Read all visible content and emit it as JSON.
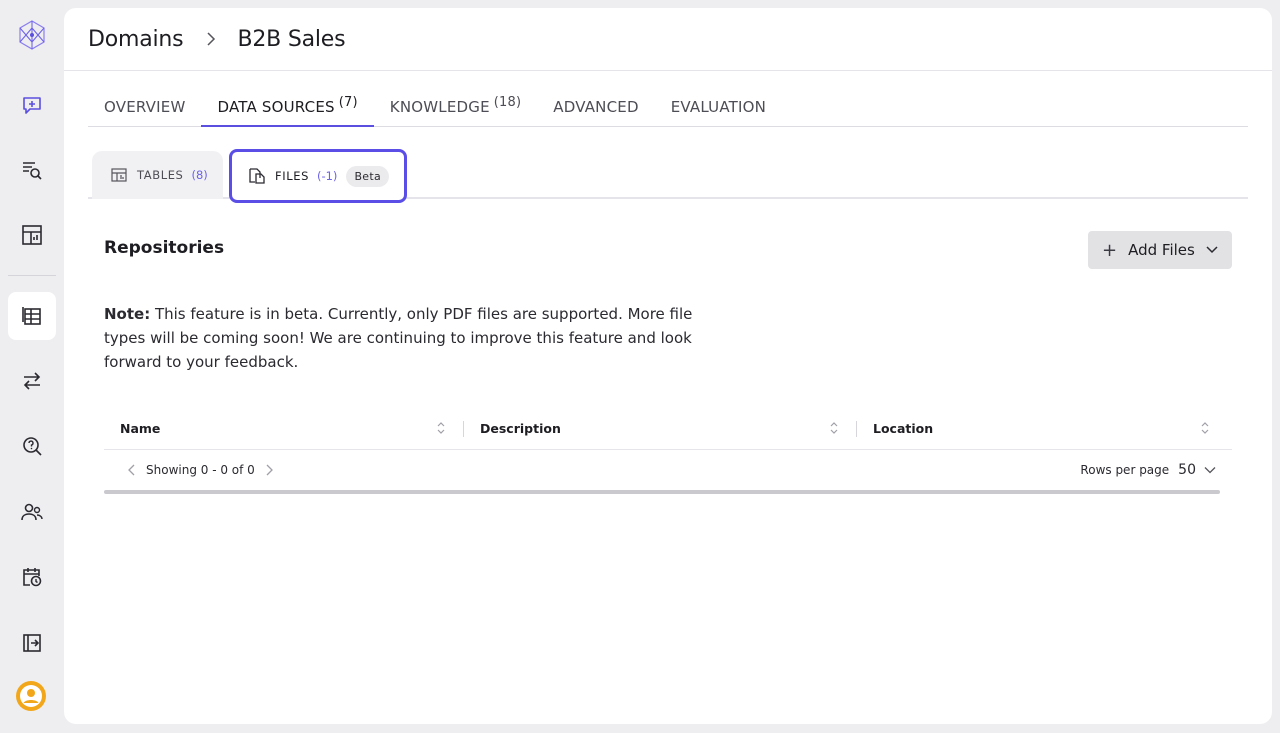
{
  "breadcrumb": {
    "root": "Domains",
    "current": "B2B Sales"
  },
  "tabs": [
    {
      "label": "OVERVIEW",
      "count": ""
    },
    {
      "label": "DATA SOURCES",
      "count": "(7)"
    },
    {
      "label": "KNOWLEDGE",
      "count": "(18)"
    },
    {
      "label": "ADVANCED",
      "count": ""
    },
    {
      "label": "EVALUATION",
      "count": ""
    }
  ],
  "subtabs": {
    "tables": {
      "label": "TABLES",
      "count": "(8)"
    },
    "files": {
      "label": "FILES",
      "count": "(-1)",
      "badge": "Beta"
    }
  },
  "section": {
    "title": "Repositories",
    "add_button": "Add Files"
  },
  "note": {
    "label": "Note:",
    "text": " This feature is in beta. Currently, only PDF files are supported. More file types will be coming soon! We are continuing to improve this feature and look forward to your feedback."
  },
  "table": {
    "columns": [
      "Name",
      "Description",
      "Location"
    ],
    "rows": []
  },
  "pager": {
    "showing": "Showing 0 - 0 of 0",
    "rows_per_page_label": "Rows per page",
    "rows_per_page": "50"
  },
  "colors": {
    "accent": "#5b4fe0",
    "avatar": "#f2a71b"
  },
  "icons": {
    "sidebar": [
      "logo-icon",
      "new-chat-icon",
      "search-list-icon",
      "dashboard-icon",
      "data-table-icon",
      "swap-icon",
      "query-search-icon",
      "users-icon",
      "schedule-icon",
      "collapse-icon",
      "user-avatar-icon"
    ]
  }
}
